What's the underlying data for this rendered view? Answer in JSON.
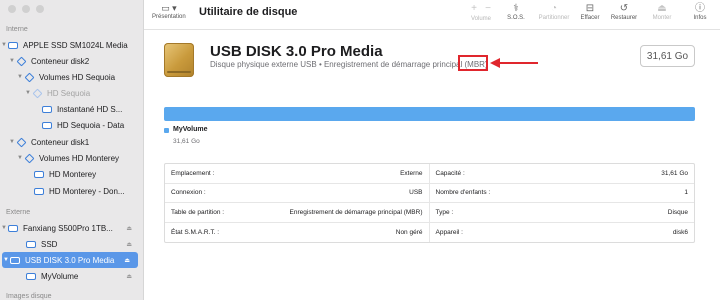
{
  "sidebar": {
    "sections": {
      "internal": "Interne",
      "external": "Externe",
      "images": "Images disque"
    },
    "items": [
      {
        "label": "APPLE SSD SM1024L Media"
      },
      {
        "label": "Conteneur disk2"
      },
      {
        "label": "Volumes HD Sequoia"
      },
      {
        "label": "HD Sequoia"
      },
      {
        "label": "Instantané HD S..."
      },
      {
        "label": "HD Sequoia - Data"
      },
      {
        "label": "Conteneur disk1"
      },
      {
        "label": "Volumes HD Monterey"
      },
      {
        "label": "HD Monterey"
      },
      {
        "label": "HD Monterey - Don..."
      },
      {
        "label": "Fanxiang S500Pro 1TB..."
      },
      {
        "label": "SSD"
      },
      {
        "label": "USB DISK 3.0 Pro Media"
      },
      {
        "label": "MyVolume"
      }
    ]
  },
  "toolbar": {
    "view_label": "Présentation",
    "title": "Utilitaire de disque",
    "buttons": {
      "volume": "Volume",
      "sos": "S.O.S.",
      "partition": "Partitionner",
      "erase": "Effacer",
      "restore": "Restaurer",
      "mount": "Monter",
      "info": "Infos"
    }
  },
  "disk": {
    "name": "USB DISK 3.0 Pro Media",
    "subtitle": "Disque physique externe USB • Enregistrement de démarrage principal (MBR)",
    "size": "31,61 Go"
  },
  "usage": {
    "volume_name": "MyVolume",
    "volume_size": "31,61 Go",
    "fill_fraction": 1.0
  },
  "info": {
    "rows": [
      {
        "left_label": "Emplacement :",
        "left_value": "Externe",
        "right_label": "Capacité :",
        "right_value": "31,61 Go"
      },
      {
        "left_label": "Connexion :",
        "left_value": "USB",
        "right_label": "Nombre d'enfants :",
        "right_value": "1"
      },
      {
        "left_label": "Table de partition :",
        "left_value": "Enregistrement de démarrage principal (MBR)",
        "right_label": "Type :",
        "right_value": "Disque"
      },
      {
        "left_label": "État S.M.A.R.T. :",
        "left_value": "Non géré",
        "right_label": "Appareil :",
        "right_value": "disk6"
      }
    ]
  },
  "colors": {
    "accent": "#5a97e8",
    "usage_bar": "#5aa8ee",
    "highlight_red": "#e0262d"
  }
}
